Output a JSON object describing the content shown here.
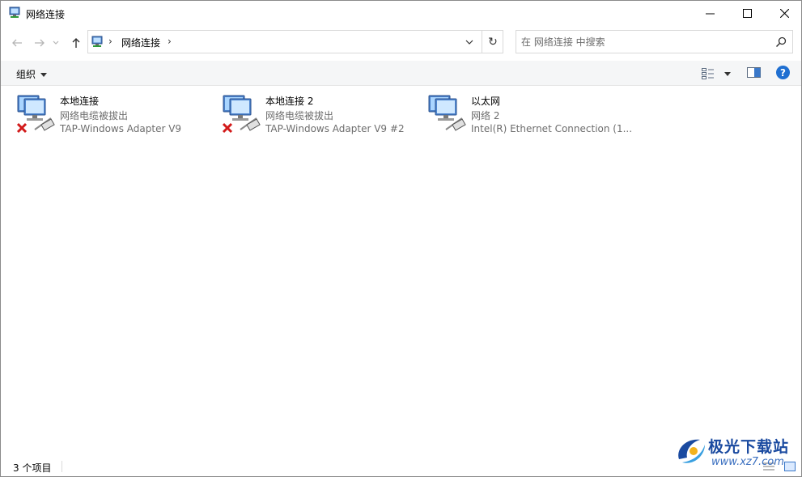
{
  "window": {
    "title": "网络连接",
    "icons": {
      "app": "network-connections-icon",
      "minimize": "minimize-icon",
      "maximize": "maximize-icon",
      "close": "close-icon"
    }
  },
  "navigation": {
    "breadcrumb": [
      "网络连接"
    ],
    "search_placeholder": "在 网络连接 中搜索",
    "icons": {
      "back": "arrow-left-icon",
      "forward": "arrow-right-icon",
      "recent": "chevron-down-icon",
      "up": "arrow-up-icon",
      "refresh": "refresh-icon",
      "search": "search-icon"
    },
    "refresh_glyph": "↻"
  },
  "commandbar": {
    "organize_label": "组织",
    "help_glyph": "?"
  },
  "connections": [
    {
      "name": "本地连接",
      "status": "网络电缆被拔出",
      "device": "TAP-Windows Adapter V9",
      "disconnected": true
    },
    {
      "name": "本地连接 2",
      "status": "网络电缆被拔出",
      "device": "TAP-Windows Adapter V9 #2",
      "disconnected": true
    },
    {
      "name": "以太网",
      "status": "网络 2",
      "device": "Intel(R) Ethernet Connection (1...",
      "disconnected": false
    }
  ],
  "statusbar": {
    "item_count": "3 个项目"
  },
  "watermark": {
    "brand": "极光下载站",
    "url": "www.xz7.com"
  },
  "colors": {
    "accent": "#1f6fd1",
    "disconnected_x": "#d21a1a",
    "secondary_text": "#6d6d6d"
  }
}
